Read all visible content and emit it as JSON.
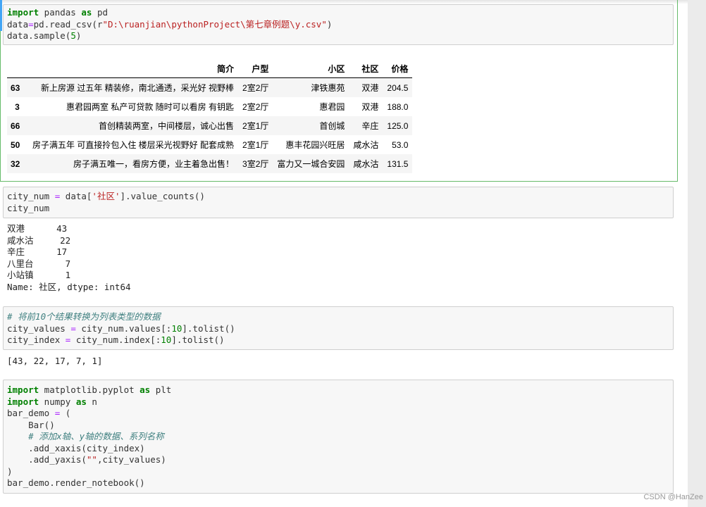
{
  "cells": [
    {
      "id": "cell1",
      "code_lines": [
        [
          {
            "t": "import",
            "c": "kw"
          },
          {
            "t": " pandas ",
            "c": "plain"
          },
          {
            "t": "as",
            "c": "kw"
          },
          {
            "t": " pd",
            "c": "plain"
          }
        ],
        [
          {
            "t": "data",
            "c": "plain"
          },
          {
            "t": "=",
            "c": "op"
          },
          {
            "t": "pd.read_csv(r",
            "c": "plain"
          },
          {
            "t": "\"D:\\ruanjian\\pythonProject\\第七章例题\\y.csv\"",
            "c": "str"
          },
          {
            "t": ")",
            "c": "plain"
          }
        ],
        [
          {
            "t": "data.sample(",
            "c": "plain"
          },
          {
            "t": "5",
            "c": "num"
          },
          {
            "t": ")",
            "c": "plain"
          }
        ]
      ],
      "table": {
        "columns": [
          "",
          "简介",
          "户型",
          "小区",
          "社区",
          "价格"
        ],
        "rows": [
          [
            "63",
            "新上房源 过五年 精装修，南北通透，采光好 视野棒",
            "2室2厅",
            "津铁惠苑",
            "双港",
            "204.5"
          ],
          [
            "3",
            "惠君园两室 私产可贷款 随时可以看房 有钥匙",
            "2室2厅",
            "惠君园",
            "双港",
            "188.0"
          ],
          [
            "66",
            "首创精装两室，中间楼层，诚心出售",
            "2室1厅",
            "首创城",
            "辛庄",
            "125.0"
          ],
          [
            "50",
            "房子满五年 可直接拎包入住 楼层采光视野好 配套成熟",
            "2室1厅",
            "惠丰花园兴旺居",
            "咸水沽",
            "53.0"
          ],
          [
            "32",
            "房子满五唯一，看房方便，业主着急出售！",
            "3室2厅",
            "富力又一城合安园",
            "咸水沽",
            "131.5"
          ]
        ]
      }
    },
    {
      "id": "cell2",
      "code_lines": [
        [
          {
            "t": "city_num ",
            "c": "plain"
          },
          {
            "t": "=",
            "c": "op"
          },
          {
            "t": " data[",
            "c": "plain"
          },
          {
            "t": "'社区'",
            "c": "str"
          },
          {
            "t": "].value_counts()",
            "c": "plain"
          }
        ],
        [
          {
            "t": "city_num",
            "c": "plain"
          }
        ]
      ],
      "output_lines": [
        "双港      43",
        "咸水沽     22",
        "辛庄      17",
        "八里台      7",
        "小站镇      1",
        "Name: 社区, dtype: int64"
      ]
    },
    {
      "id": "cell3",
      "code_lines": [
        [
          {
            "t": "# 将前10个结果转换为列表类型的数据",
            "c": "cm"
          }
        ],
        [
          {
            "t": "city_values ",
            "c": "plain"
          },
          {
            "t": "=",
            "c": "op"
          },
          {
            "t": " city_num.values[:",
            "c": "plain"
          },
          {
            "t": "10",
            "c": "num"
          },
          {
            "t": "].tolist()",
            "c": "plain"
          }
        ],
        [
          {
            "t": "city_index ",
            "c": "plain"
          },
          {
            "t": "=",
            "c": "op"
          },
          {
            "t": " city_num.index[:",
            "c": "plain"
          },
          {
            "t": "10",
            "c": "num"
          },
          {
            "t": "].tolist()",
            "c": "plain"
          }
        ]
      ],
      "output_lines": [
        "[43, 22, 17, 7, 1]"
      ]
    },
    {
      "id": "cell4",
      "code_lines": [
        [
          {
            "t": "import",
            "c": "kw"
          },
          {
            "t": " matplotlib.pyplot ",
            "c": "plain"
          },
          {
            "t": "as",
            "c": "kw"
          },
          {
            "t": " plt",
            "c": "plain"
          }
        ],
        [
          {
            "t": "import",
            "c": "kw"
          },
          {
            "t": " numpy ",
            "c": "plain"
          },
          {
            "t": "as",
            "c": "kw"
          },
          {
            "t": " n",
            "c": "plain"
          }
        ],
        [
          {
            "t": "bar_demo ",
            "c": "plain"
          },
          {
            "t": "=",
            "c": "op"
          },
          {
            "t": " (",
            "c": "plain"
          }
        ],
        [
          {
            "t": "    Bar()",
            "c": "plain"
          }
        ],
        [
          {
            "t": "    # 添加x轴、y轴的数据、系列名称",
            "c": "cm"
          }
        ],
        [
          {
            "t": "    .add_xaxis(city_index)",
            "c": "plain"
          }
        ],
        [
          {
            "t": "    .add_yaxis(",
            "c": "plain"
          },
          {
            "t": "\"\"",
            "c": "str"
          },
          {
            "t": ",city_values)",
            "c": "plain"
          }
        ],
        [
          {
            "t": ")",
            "c": "plain"
          }
        ],
        [
          {
            "t": "bar_demo.render_notebook()",
            "c": "plain"
          }
        ]
      ]
    }
  ],
  "watermark": "CSDN @HanZee"
}
